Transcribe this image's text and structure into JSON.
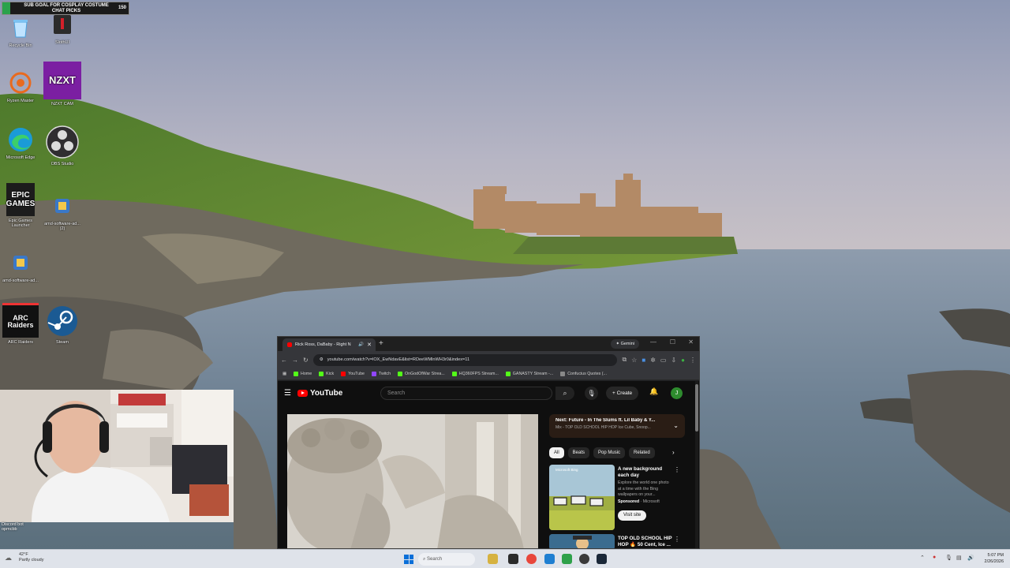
{
  "overlay": {
    "goal_text": "SUB GOAL FOR COSPLAY COSTUME CHAT PICKS",
    "goal_count": "150",
    "goal_progress": 0.06
  },
  "desktop_icons": [
    {
      "label": "Recycle Bin"
    },
    {
      "label": "SlothUI"
    },
    {
      "label": "Ryzen Master"
    },
    {
      "label": "NZXT CAM",
      "tile_text": "NZXT"
    },
    {
      "label": "Microsoft Edge"
    },
    {
      "label": "OBS Studio"
    },
    {
      "label": "Epic Games Launcher",
      "tile_text": "EPIC\nGAMES"
    },
    {
      "label": "amd-software-ad... (2)"
    },
    {
      "label": "amd-software-ad..."
    },
    {
      "label": "ARC Raiders",
      "tile_text": "ARC\nRaiders"
    },
    {
      "label": "Steam"
    }
  ],
  "browser": {
    "tab_title": "Rick Ross, DaBaby - Right N",
    "gemini_label": "Gemini",
    "url": "youtube.com/watch?v=lOX_EwNdavE&list=RDeeWMlnWH3r0&index=11",
    "bookmarks": [
      "Home",
      "Kick",
      "YouTube",
      "Twitch",
      "OnGodOfWar Strea...",
      "HQ360FPS Stream...",
      "GANASTY Stream -...",
      "Confucius Quotes (..."
    ],
    "bookmark_colors": [
      "#53fc18",
      "#53fc18",
      "#ff0000",
      "#9146ff",
      "#53fc18",
      "#53fc18",
      "#53fc18",
      "#888888"
    ]
  },
  "youtube": {
    "logo_text": "YouTube",
    "search_placeholder": "Search",
    "create_label": "Create",
    "avatar_initial": "J",
    "next_title": "Next: Future - In The Slums ft. Lil Baby & Y...",
    "next_sub": "Mix - TOP OLD SCHOOL HIP HOP Ice Cube, Snoop...",
    "chips": [
      "All",
      "Beats",
      "Pop Music",
      "Related"
    ],
    "recommendations": [
      {
        "thumb_label": "Microsoft Bing",
        "title": "A new background each day",
        "desc": "Explore the world one photo at a time with the Bing wallpapers on your...",
        "sponsored": "Sponsored",
        "advertiser": "Microsoft",
        "cta": "Visit site"
      },
      {
        "title": "TOP OLD SCHOOL HIP HOP 🔥 50 Cent, Ice ..."
      }
    ]
  },
  "webcam": {
    "caption": "Discord bot\nopmcbb"
  },
  "taskbar": {
    "weather_temp": "42°F",
    "weather_desc": "Partly cloudy",
    "search_label": "Search",
    "time": "5:07 PM",
    "date": "2/26/2026"
  }
}
